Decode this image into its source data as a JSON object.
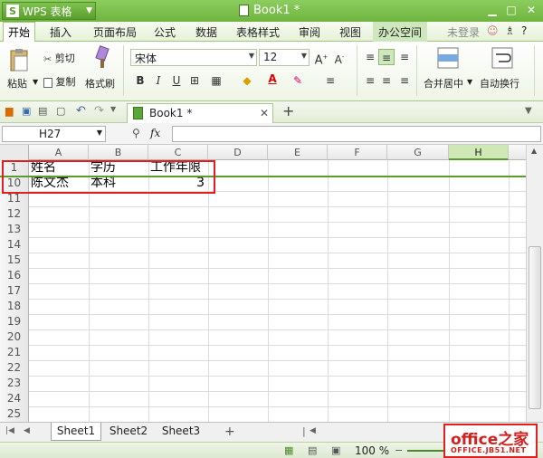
{
  "app": {
    "name": "WPS 表格",
    "logo": "S",
    "doc_title": "Book1 *"
  },
  "menu": [
    "开始",
    "插入",
    "页面布局",
    "公式",
    "数据",
    "表格样式",
    "审阅",
    "视图",
    "办公空间",
    "未登录"
  ],
  "ribbon": {
    "paste": "粘贴",
    "cut": "剪切",
    "copy": "复制",
    "format_painter": "格式刷",
    "font": "宋体",
    "font_size": "12",
    "bold": "B",
    "italic": "I",
    "underline": "U",
    "merge": "合并居中",
    "wrap": "自动换行"
  },
  "quickbar": {
    "doc_tab": "Book1 *"
  },
  "formula": {
    "name_box": "H27",
    "fx": "fx"
  },
  "columns": [
    "A",
    "B",
    "C",
    "D",
    "E",
    "F",
    "G",
    "H"
  ],
  "rows": [
    {
      "n": "1",
      "a": "姓名",
      "b": "学历",
      "c": "工作年限"
    },
    {
      "n": "10",
      "a": "陈文杰",
      "b": "本科",
      "c": "3"
    },
    {
      "n": "11"
    },
    {
      "n": "12"
    },
    {
      "n": "13"
    },
    {
      "n": "14"
    },
    {
      "n": "15"
    },
    {
      "n": "16"
    },
    {
      "n": "17"
    },
    {
      "n": "18"
    },
    {
      "n": "19"
    },
    {
      "n": "20"
    },
    {
      "n": "21"
    },
    {
      "n": "22"
    },
    {
      "n": "23"
    },
    {
      "n": "24"
    },
    {
      "n": "25"
    }
  ],
  "sheets": [
    "Sheet1",
    "Sheet2",
    "Sheet3"
  ],
  "status": {
    "zoom": "100 %"
  },
  "watermark": {
    "brand": "office之家",
    "url": "OFFICE.JB51.NET"
  },
  "colors": {
    "accent": "#6fb43f",
    "highlight": "#e02020"
  }
}
